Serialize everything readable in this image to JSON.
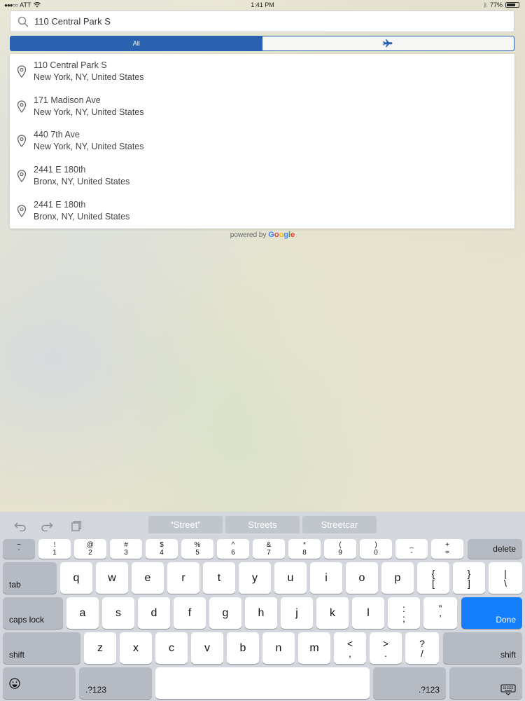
{
  "status_bar": {
    "carrier": "ATT",
    "time": "1:41 PM",
    "battery_percent": "77%",
    "battery_level": 0.77
  },
  "search": {
    "value": "110 Central Park S",
    "icon": "search-icon"
  },
  "segments": {
    "all_label": "All",
    "airport_icon": "airplane-icon",
    "selected": "All",
    "accent_color": "#2a62b0"
  },
  "results": [
    {
      "line1": "110 Central Park S",
      "line2": "New York, NY, United States"
    },
    {
      "line1": "171 Madison Ave",
      "line2": "New York, NY, United States"
    },
    {
      "line1": "440 7th Ave",
      "line2": "New York, NY, United States"
    },
    {
      "line1": "2441 E 180th",
      "line2": "Bronx, NY, United States"
    },
    {
      "line1": "2441 E 180th",
      "line2": "Bronx, NY, United States"
    }
  ],
  "attribution": {
    "prefix": "powered by",
    "brand": "Google"
  },
  "keyboard": {
    "suggestions": [
      "“Street”",
      "Streets",
      "Streetcar"
    ],
    "number_row": [
      {
        "top": "~",
        "bottom": "`"
      },
      {
        "top": "!",
        "bottom": "1"
      },
      {
        "top": "@",
        "bottom": "2"
      },
      {
        "top": "#",
        "bottom": "3"
      },
      {
        "top": "$",
        "bottom": "4"
      },
      {
        "top": "%",
        "bottom": "5"
      },
      {
        "top": "^",
        "bottom": "6"
      },
      {
        "top": "&",
        "bottom": "7"
      },
      {
        "top": "*",
        "bottom": "8"
      },
      {
        "top": "(",
        "bottom": "9"
      },
      {
        "top": ")",
        "bottom": "0"
      },
      {
        "top": "_",
        "bottom": "-"
      },
      {
        "top": "+",
        "bottom": "="
      }
    ],
    "delete": "delete",
    "tab": "tab",
    "row1": [
      "q",
      "w",
      "e",
      "r",
      "t",
      "y",
      "u",
      "i",
      "o",
      "p"
    ],
    "row1_sym": [
      {
        "top": "{",
        "bottom": "["
      },
      {
        "top": "}",
        "bottom": "]"
      },
      {
        "top": "|",
        "bottom": "\\"
      }
    ],
    "caps_lock": "caps lock",
    "row2": [
      "a",
      "s",
      "d",
      "f",
      "g",
      "h",
      "j",
      "k",
      "l"
    ],
    "row2_sym": [
      {
        "top": ":",
        "bottom": ";"
      },
      {
        "top": "”",
        "bottom": "’"
      }
    ],
    "done": "Done",
    "shift": "shift",
    "row3": [
      "z",
      "x",
      "c",
      "v",
      "b",
      "n",
      "m"
    ],
    "row3_sym": [
      {
        "top": "<",
        "bottom": ","
      },
      {
        "top": ">",
        "bottom": "."
      },
      {
        "top": "?",
        "bottom": "/"
      }
    ],
    "numbers_key": ".?123",
    "emoji_icon": "emoji-icon",
    "dismiss_icon": "keyboard-dismiss-icon"
  }
}
